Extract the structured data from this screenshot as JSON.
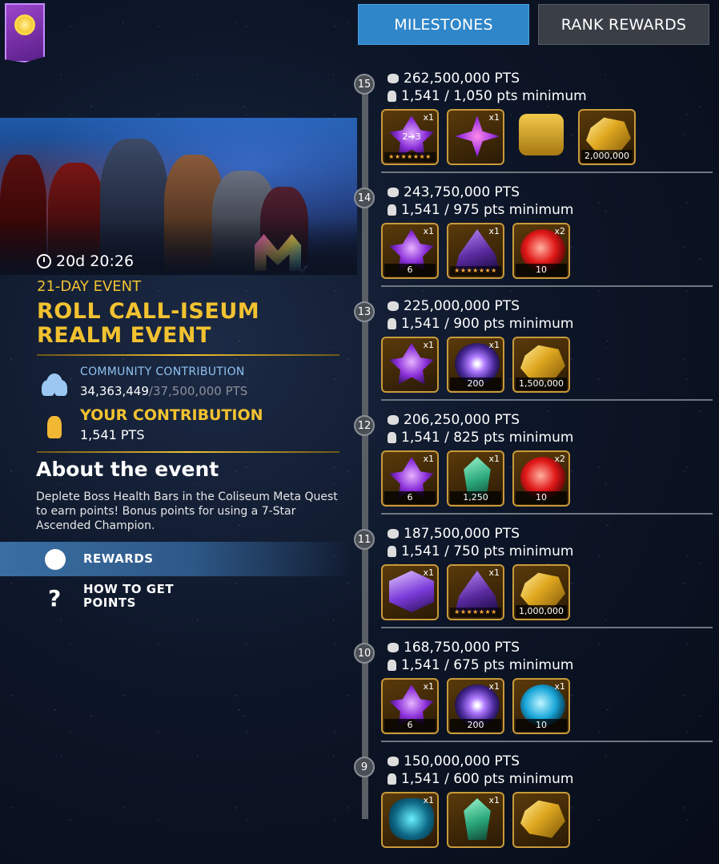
{
  "tabs": {
    "milestones": "MILESTONES",
    "rank_rewards": "RANK REWARDS"
  },
  "event": {
    "timer": "20d 20:26",
    "length": "21-DAY EVENT",
    "title": "ROLL CALL-ISEUM REALM EVENT",
    "community_label": "COMMUNITY CONTRIBUTION",
    "community_current": "34,363,449",
    "community_goal": "/37,500,000 PTS",
    "your_label": "YOUR CONTRIBUTION",
    "your_value": "1,541 PTS",
    "about_title": "About the event",
    "about_text": "Deplete Boss Health Bars in the Coliseum Meta Quest to earn points! Bonus points for using a 7-Star Ascended Champion."
  },
  "menu": {
    "rewards": "REWARDS",
    "how_to": "HOW TO GET POINTS"
  },
  "milestones": [
    {
      "rank": "15",
      "pts": "262,500,000 PTS",
      "min": "1,541 / 1,050 pts minimum",
      "rewards": [
        {
          "icon": "crystal-purple",
          "qty": "x1",
          "count": "",
          "stars": "★★★★★★★",
          "text": "2➔3"
        },
        {
          "icon": "sig-star",
          "qty": "x1",
          "count": ""
        },
        {
          "icon": "chest",
          "qty": "",
          "count": "",
          "plain": true
        },
        {
          "icon": "gold",
          "qty": "",
          "count": "2,000,000"
        }
      ]
    },
    {
      "rank": "14",
      "pts": "243,750,000 PTS",
      "min": "1,541 / 975 pts minimum",
      "rewards": [
        {
          "icon": "crystal-purple",
          "qty": "x1",
          "count": "6"
        },
        {
          "icon": "hat",
          "qty": "x1",
          "count": "",
          "stars": "★★★★★★★"
        },
        {
          "icon": "red-shard",
          "qty": "x2",
          "count": "10"
        }
      ]
    },
    {
      "rank": "13",
      "pts": "225,000,000 PTS",
      "min": "1,541 / 900 pts minimum",
      "rewards": [
        {
          "icon": "crystal-purple",
          "qty": "x1",
          "count": ""
        },
        {
          "icon": "galaxy",
          "qty": "x1",
          "count": "200"
        },
        {
          "icon": "gold",
          "qty": "",
          "count": "1,500,000"
        }
      ]
    },
    {
      "rank": "12",
      "pts": "206,250,000 PTS",
      "min": "1,541 / 825 pts minimum",
      "rewards": [
        {
          "icon": "crystal-purple",
          "qty": "x1",
          "count": "6"
        },
        {
          "icon": "green-gem",
          "qty": "x1",
          "count": "1,250"
        },
        {
          "icon": "red-shard",
          "qty": "x2",
          "count": "10"
        }
      ]
    },
    {
      "rank": "11",
      "pts": "187,500,000 PTS",
      "min": "1,541 / 750 pts minimum",
      "rewards": [
        {
          "icon": "cube",
          "qty": "x1",
          "count": ""
        },
        {
          "icon": "hat",
          "qty": "x1",
          "count": "",
          "stars": "★★★★★★★"
        },
        {
          "icon": "gold",
          "qty": "",
          "count": "1,000,000"
        }
      ]
    },
    {
      "rank": "10",
      "pts": "168,750,000 PTS",
      "min": "1,541 / 675 pts minimum",
      "rewards": [
        {
          "icon": "crystal-purple",
          "qty": "x1",
          "count": "6"
        },
        {
          "icon": "galaxy",
          "qty": "x1",
          "count": "200"
        },
        {
          "icon": "blue-shard",
          "qty": "x1",
          "count": "10"
        }
      ]
    },
    {
      "rank": "9",
      "pts": "150,000,000 PTS",
      "min": "1,541 / 600 pts minimum",
      "rewards": [
        {
          "icon": "teal-champ",
          "qty": "x1",
          "count": ""
        },
        {
          "icon": "green-gem",
          "qty": "x1",
          "count": ""
        },
        {
          "icon": "gold",
          "qty": "",
          "count": ""
        }
      ]
    }
  ]
}
